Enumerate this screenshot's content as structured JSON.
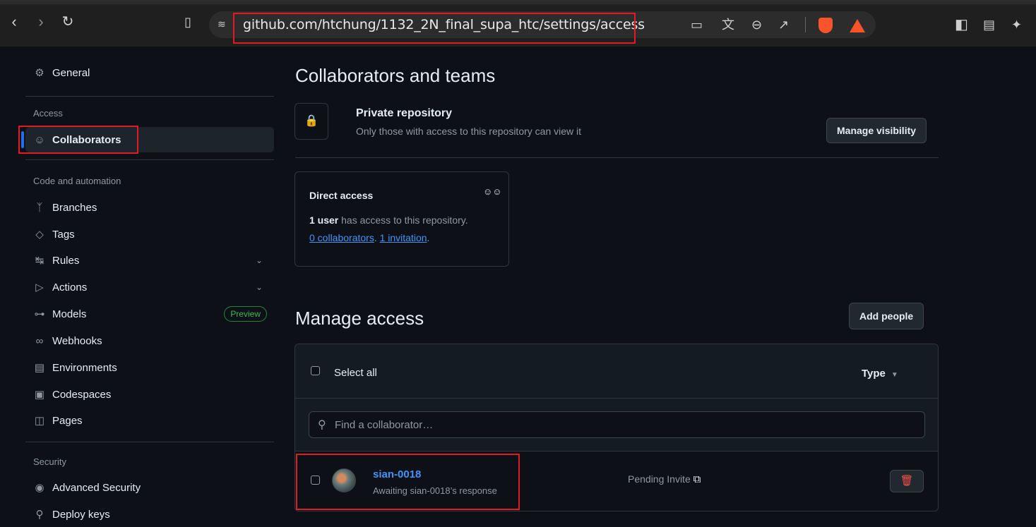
{
  "browser": {
    "url": "github.com/htchung/1132_2N_final_supa_htc/settings/access",
    "icons": [
      "back-icon",
      "forward-icon",
      "reload-icon",
      "bookmark-icon",
      "site-settings-icon",
      "cast-icon",
      "translate-icon",
      "zoom-icon",
      "share-icon",
      "brave-shield-icon",
      "brave-rewards-icon",
      "sidebar-icon",
      "wallet-icon",
      "leo-icon"
    ],
    "highlight_color": "#e01b24"
  },
  "sidebar": {
    "general": "General",
    "access_heading": "Access",
    "collaborators": "Collaborators",
    "code_heading": "Code and automation",
    "branches": "Branches",
    "tags": "Tags",
    "rules": "Rules",
    "actions": "Actions",
    "models": "Models",
    "preview_badge": "Preview",
    "webhooks": "Webhooks",
    "environments": "Environments",
    "codespaces": "Codespaces",
    "pages": "Pages",
    "security_heading": "Security",
    "advanced_security": "Advanced Security",
    "deploy_keys": "Deploy keys"
  },
  "main": {
    "title": "Collaborators and teams",
    "private_title": "Private repository",
    "private_desc": "Only those with access to this repository can view it",
    "manage_visibility": "Manage visibility",
    "direct_access": {
      "title": "Direct access",
      "user_count": "1 user",
      "line1_rest": " has access to this repository.",
      "collaborators_link": "0 collaborators",
      "sep": ". ",
      "invitation_link": "1 invitation",
      "end": "."
    },
    "manage_access_title": "Manage access",
    "add_people": "Add people",
    "select_all": "Select all",
    "type_label": "Type",
    "search_placeholder": "Find a collaborator…",
    "collaborator": {
      "name": "sian-0018",
      "status": "Awaiting sian-0018’s response",
      "pending": "Pending Invite"
    }
  }
}
